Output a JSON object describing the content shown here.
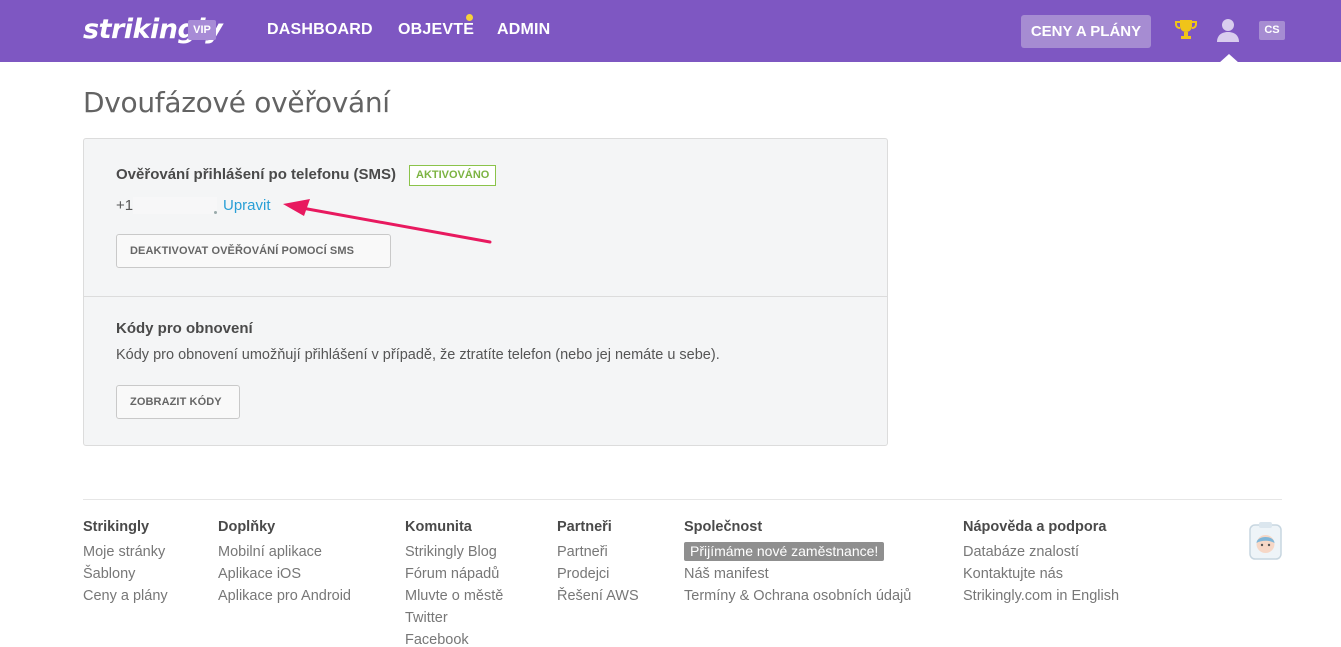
{
  "header": {
    "brand": "strikingly",
    "vip_badge": "VIP",
    "nav": [
      {
        "label": "DASHBOARD"
      },
      {
        "label": "OBJEVTE"
      },
      {
        "label": "ADMIN"
      }
    ],
    "cta_label": "CENY A PLÁNY",
    "lang_label": "CS",
    "colors": {
      "bar": "#7e57c2",
      "notify_dot": "#f6d13a"
    }
  },
  "page": {
    "title": "Dvoufázové ověřování"
  },
  "sms_section": {
    "title": "Ověřování přihlášení po telefonu (SMS)",
    "status_badge": "AKTIVOVÁNO",
    "phone_prefix": "+1",
    "edit_link": "Upravit",
    "deactivate_button": "DEAKTIVOVAT OVĚŘOVÁNÍ POMOCÍ SMS"
  },
  "recovery_section": {
    "title": "Kódy pro obnovení",
    "description": "Kódy pro obnovení umožňují přihlášení v případě, že ztratíte telefon (nebo jej nemáte u sebe).",
    "show_codes_button": "ZOBRAZIT KÓDY"
  },
  "footer": {
    "columns": [
      {
        "heading": "Strikingly",
        "links": [
          "Moje stránky",
          "Šablony",
          "Ceny a plány"
        ]
      },
      {
        "heading": "Doplňky",
        "links": [
          "Mobilní aplikace",
          "Aplikace iOS",
          "Aplikace pro Android"
        ]
      },
      {
        "heading": "Komunita",
        "links": [
          "Strikingly Blog",
          "Fórum nápadů",
          "Mluvte o městě",
          "Twitter",
          "Facebook"
        ]
      },
      {
        "heading": "Partneři",
        "links": [
          "Partneři",
          "Prodejci",
          "Řešení AWS"
        ]
      },
      {
        "heading": "Společnost",
        "hiring_badge": "Přijímáme nové zaměstnance!",
        "links": [
          "Náš manifest",
          "Termíny & Ochrana osobních údajů"
        ]
      },
      {
        "heading": "Nápověda a podpora",
        "links": [
          "Databáze znalostí",
          "Kontaktujte nás",
          "Strikingly.com in English"
        ]
      }
    ]
  },
  "icons": {
    "trophy": "trophy-icon",
    "user": "user-icon",
    "mascot": "mascot-icon",
    "annotation": "arrow-annotation"
  }
}
